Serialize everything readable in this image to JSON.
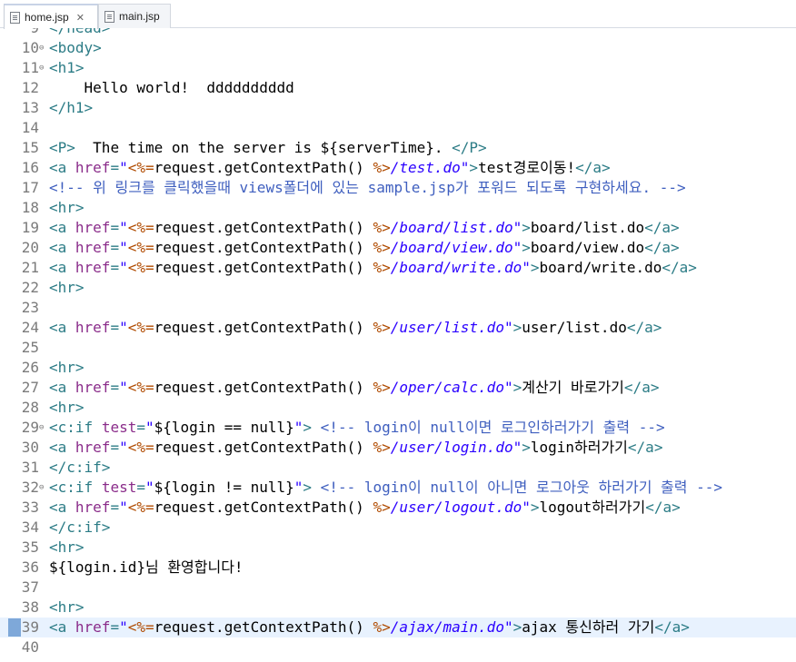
{
  "tabs": [
    {
      "label": "home.jsp",
      "icon": "jsp-file-icon",
      "close": "✕",
      "active": true
    },
    {
      "label": "main.jsp",
      "icon": "jsp-file-icon",
      "active": false
    }
  ],
  "lines": [
    {
      "n": "9",
      "text": "</head>",
      "fold": false
    },
    {
      "n": "10",
      "text": "<body>",
      "fold": true
    },
    {
      "n": "11",
      "text": "<h1>",
      "fold": true
    },
    {
      "n": "12",
      "text": "    Hello world!  dddddddddd"
    },
    {
      "n": "13",
      "text": "</h1>"
    },
    {
      "n": "14",
      "text": ""
    },
    {
      "n": "15",
      "text": "<P>  The time on the server is ${serverTime}. </P>"
    },
    {
      "n": "16",
      "text": "<a href=\"<%=request.getContextPath() %>/test.do\">test경로이동!</a>"
    },
    {
      "n": "17",
      "text": "<!-- 위 링크를 클릭했을때 views폴더에 있는 sample.jsp가 포워드 되도록 구현하세요. -->"
    },
    {
      "n": "18",
      "text": "<hr>"
    },
    {
      "n": "19",
      "text": "<a href=\"<%=request.getContextPath() %>/board/list.do\">board/list.do</a>"
    },
    {
      "n": "20",
      "text": "<a href=\"<%=request.getContextPath() %>/board/view.do\">board/view.do</a>"
    },
    {
      "n": "21",
      "text": "<a href=\"<%=request.getContextPath() %>/board/write.do\">board/write.do</a>"
    },
    {
      "n": "22",
      "text": "<hr>"
    },
    {
      "n": "23",
      "text": ""
    },
    {
      "n": "24",
      "text": "<a href=\"<%=request.getContextPath() %>/user/list.do\">user/list.do</a>"
    },
    {
      "n": "25",
      "text": ""
    },
    {
      "n": "26",
      "text": "<hr>"
    },
    {
      "n": "27",
      "text": "<a href=\"<%=request.getContextPath() %>/oper/calc.do\">계산기 바로가기</a>"
    },
    {
      "n": "28",
      "text": "<hr>"
    },
    {
      "n": "29",
      "text": "<c:if test=\"${login == null}\"> <!-- login이 null이면 로그인하러가기 출력 -->",
      "fold": true
    },
    {
      "n": "30",
      "text": "<a href=\"<%=request.getContextPath() %>/user/login.do\">login하러가기</a>"
    },
    {
      "n": "31",
      "text": "</c:if>"
    },
    {
      "n": "32",
      "text": "<c:if test=\"${login != null}\"> <!-- login이 null이 아니면 로그아웃 하러가기 출력 -->",
      "fold": true
    },
    {
      "n": "33",
      "text": "<a href=\"<%=request.getContextPath() %>/user/logout.do\">logout하러가기</a>"
    },
    {
      "n": "34",
      "text": "</c:if>"
    },
    {
      "n": "35",
      "text": "<hr>"
    },
    {
      "n": "36",
      "text": "${login.id}님 환영합니다!"
    },
    {
      "n": "37",
      "text": ""
    },
    {
      "n": "38",
      "text": "<hr>"
    },
    {
      "n": "39",
      "text": "<a href=\"<%=request.getContextPath() %>/ajax/main.do\">ajax 통신하러 가기</a>",
      "current": true
    },
    {
      "n": "40",
      "text": ""
    }
  ],
  "colors": {
    "tag": "#2c7c86",
    "attribute": "#8a2c8a",
    "string": "#2a00ff",
    "scriptlet": "#b04b00",
    "comment": "#3f5fbf",
    "current_line": "#e8f2fe",
    "line_number": "#7b7b7b"
  }
}
